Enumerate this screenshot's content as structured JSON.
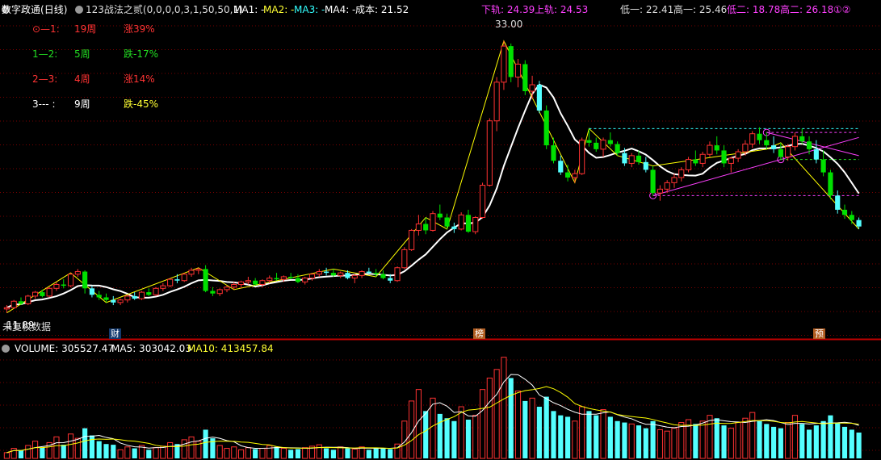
{
  "header": {
    "title": "数字政通",
    "period": "(日线)",
    "indicator": "123战法之贰(0,0,0,0,3,1,50,50,1)",
    "ma1": "MA1: -",
    "ma2": "MA2: -",
    "ma3": "MA3: -",
    "ma4": "MA4: -",
    "cost": "成本: 21.52",
    "lower_track": "下轨: 24.39",
    "upper_track": "上轨: 24.53",
    "low1": "低一: 22.41",
    "high1": "高一: 25.46",
    "low2": "低二: 18.78",
    "high2": "高二: 26.18",
    "circled": "①②"
  },
  "legend_rows": [
    {
      "label": "⊙—1:",
      "weeks": "19周",
      "change": "涨39%",
      "color": "#ff3333",
      "change_color": "#ff3333"
    },
    {
      "label": "1—2:",
      "weeks": "5周",
      "change": "跌-17%",
      "color": "#22dd22",
      "change_color": "#22dd22"
    },
    {
      "label": "2—3:",
      "weeks": "4周",
      "change": "涨14%",
      "color": "#ff3333",
      "change_color": "#ff3333"
    },
    {
      "label": "3--- :",
      "weeks": "9周",
      "change": "跌-45%",
      "color": "#ffffff",
      "change_color": "#ffff33"
    }
  ],
  "annotations": {
    "peak_label": "33.00",
    "low_label": "11.89",
    "no_data": "未复权数据",
    "tag_cai": "财",
    "tag_bang": "榜",
    "tag_yu": "预"
  },
  "volume_header": {
    "volume": "VOLUME: 305527.47",
    "ma5": "MA5: 303042.03",
    "ma10": "MA10: 413457.84"
  },
  "colors": {
    "up": "#ff3232",
    "down": "#54ffff",
    "down_candle": "#00e000",
    "ma": "#ffffff",
    "zigzag": "#ffff00",
    "channel": "#ff40ff",
    "ma5_vol": "#ffffff",
    "ma10_vol": "#ffff00",
    "grid": "#7a0000"
  },
  "chart_data": {
    "type": "candlestick",
    "price_range": [
      10.5,
      34.8
    ],
    "volume_range": [
      0,
      720000
    ],
    "peak": 33.0,
    "trough": 11.89,
    "ohlc": [
      [
        12.2,
        12.5,
        11.9,
        12.3
      ],
      [
        12.3,
        12.9,
        12.2,
        12.8
      ],
      [
        12.8,
        13.1,
        12.5,
        12.6
      ],
      [
        12.6,
        13.3,
        12.5,
        13.2
      ],
      [
        13.2,
        13.6,
        13.0,
        13.5
      ],
      [
        13.5,
        13.7,
        13.1,
        13.2
      ],
      [
        13.2,
        13.9,
        13.1,
        13.8
      ],
      [
        13.8,
        14.3,
        13.6,
        14.1
      ],
      [
        14.1,
        14.5,
        13.8,
        14.0
      ],
      [
        14.0,
        15.0,
        13.9,
        14.9
      ],
      [
        14.9,
        15.3,
        14.7,
        15.1
      ],
      [
        15.1,
        15.2,
        13.4,
        13.8
      ],
      [
        13.8,
        14.0,
        13.1,
        13.3
      ],
      [
        13.3,
        13.6,
        12.9,
        13.1
      ],
      [
        13.1,
        13.4,
        12.7,
        12.9
      ],
      [
        12.9,
        13.2,
        12.5,
        12.7
      ],
      [
        12.7,
        13.0,
        12.5,
        12.9
      ],
      [
        12.9,
        13.3,
        12.7,
        13.2
      ],
      [
        13.2,
        13.5,
        12.9,
        13.0
      ],
      [
        13.0,
        13.6,
        12.9,
        13.5
      ],
      [
        13.5,
        13.8,
        13.2,
        13.3
      ],
      [
        13.3,
        13.9,
        13.2,
        13.8
      ],
      [
        13.8,
        14.2,
        13.6,
        14.0
      ],
      [
        14.0,
        14.6,
        13.9,
        14.5
      ],
      [
        14.5,
        14.9,
        14.2,
        14.4
      ],
      [
        14.4,
        15.0,
        14.3,
        14.9
      ],
      [
        14.9,
        15.4,
        14.7,
        15.2
      ],
      [
        15.2,
        15.4,
        14.9,
        15.3
      ],
      [
        15.3,
        15.6,
        13.5,
        13.6
      ],
      [
        13.6,
        13.9,
        13.2,
        13.4
      ],
      [
        13.4,
        13.8,
        13.2,
        13.7
      ],
      [
        13.7,
        14.0,
        13.5,
        13.9
      ],
      [
        13.9,
        14.3,
        13.7,
        14.1
      ],
      [
        14.1,
        14.4,
        13.8,
        14.3
      ],
      [
        14.3,
        14.7,
        14.1,
        14.4
      ],
      [
        14.4,
        14.6,
        14.0,
        14.1
      ],
      [
        14.1,
        14.5,
        13.9,
        14.4
      ],
      [
        14.4,
        14.8,
        14.2,
        14.6
      ],
      [
        14.6,
        15.0,
        14.4,
        14.5
      ],
      [
        14.5,
        14.8,
        14.3,
        14.7
      ],
      [
        14.7,
        15.0,
        14.5,
        14.6
      ],
      [
        14.6,
        14.9,
        14.2,
        14.3
      ],
      [
        14.3,
        14.7,
        14.1,
        14.6
      ],
      [
        14.6,
        15.0,
        14.4,
        14.9
      ],
      [
        14.9,
        15.3,
        14.7,
        15.1
      ],
      [
        15.1,
        15.4,
        14.8,
        15.0
      ],
      [
        15.0,
        15.3,
        14.7,
        14.8
      ],
      [
        14.8,
        15.1,
        14.6,
        15.0
      ],
      [
        15.0,
        15.2,
        14.5,
        14.6
      ],
      [
        14.6,
        14.9,
        14.2,
        14.8
      ],
      [
        14.8,
        15.2,
        14.6,
        15.1
      ],
      [
        15.1,
        15.4,
        14.9,
        15.0
      ],
      [
        15.0,
        15.3,
        14.7,
        14.9
      ],
      [
        14.9,
        15.2,
        14.5,
        14.6
      ],
      [
        14.6,
        14.9,
        14.2,
        14.4
      ],
      [
        14.4,
        15.5,
        14.3,
        15.4
      ],
      [
        15.4,
        17.0,
        15.3,
        16.8
      ],
      [
        16.8,
        18.4,
        16.7,
        18.3
      ],
      [
        18.3,
        19.5,
        17.9,
        18.8
      ],
      [
        18.8,
        19.3,
        18.0,
        18.3
      ],
      [
        18.3,
        19.8,
        18.2,
        19.6
      ],
      [
        19.6,
        20.3,
        19.1,
        19.3
      ],
      [
        19.3,
        19.6,
        18.4,
        18.6
      ],
      [
        18.6,
        18.9,
        18.1,
        18.4
      ],
      [
        18.4,
        19.7,
        18.3,
        19.5
      ],
      [
        19.5,
        19.9,
        18.1,
        18.2
      ],
      [
        18.2,
        19.4,
        18.0,
        19.3
      ],
      [
        19.3,
        22.0,
        19.2,
        21.8
      ],
      [
        21.8,
        27.0,
        21.7,
        26.8
      ],
      [
        26.8,
        30.2,
        26.0,
        29.8
      ],
      [
        29.8,
        33.0,
        29.2,
        32.6
      ],
      [
        32.6,
        32.8,
        29.8,
        30.2
      ],
      [
        30.2,
        31.6,
        29.4,
        31.2
      ],
      [
        31.2,
        31.5,
        28.8,
        29.1
      ],
      [
        29.1,
        30.3,
        28.5,
        29.6
      ],
      [
        29.6,
        29.9,
        27.4,
        27.6
      ],
      [
        27.6,
        28.0,
        24.6,
        24.9
      ],
      [
        24.9,
        25.5,
        23.5,
        23.7
      ],
      [
        23.7,
        24.1,
        22.6,
        22.8
      ],
      [
        22.8,
        23.4,
        22.1,
        22.4
      ],
      [
        22.4,
        23.0,
        22.0,
        22.7
      ],
      [
        22.7,
        25.5,
        22.6,
        25.3
      ],
      [
        25.3,
        26.2,
        24.8,
        25.1
      ],
      [
        25.1,
        25.5,
        24.4,
        24.6
      ],
      [
        24.6,
        25.5,
        24.0,
        25.3
      ],
      [
        25.3,
        25.9,
        24.8,
        25.0
      ],
      [
        25.0,
        25.2,
        24.1,
        24.3
      ],
      [
        24.3,
        24.7,
        23.3,
        23.5
      ],
      [
        23.5,
        24.3,
        23.2,
        24.1
      ],
      [
        24.1,
        24.5,
        23.4,
        23.6
      ],
      [
        23.6,
        24.0,
        22.8,
        23.0
      ],
      [
        23.0,
        23.3,
        21.0,
        21.2
      ],
      [
        21.2,
        21.8,
        20.6,
        21.5
      ],
      [
        21.5,
        22.2,
        21.2,
        22.0
      ],
      [
        22.0,
        22.7,
        21.6,
        22.4
      ],
      [
        22.4,
        23.2,
        22.1,
        23.0
      ],
      [
        23.0,
        24.0,
        22.8,
        23.8
      ],
      [
        23.8,
        24.5,
        23.3,
        23.5
      ],
      [
        23.5,
        24.4,
        23.2,
        24.2
      ],
      [
        24.2,
        25.2,
        24.0,
        24.9
      ],
      [
        24.9,
        25.6,
        24.2,
        24.5
      ],
      [
        24.5,
        24.9,
        23.2,
        23.5
      ],
      [
        23.5,
        24.0,
        22.8,
        23.9
      ],
      [
        23.9,
        24.6,
        23.6,
        24.4
      ],
      [
        24.4,
        25.3,
        24.1,
        25.0
      ],
      [
        25.0,
        26.0,
        24.7,
        25.8
      ],
      [
        25.8,
        26.3,
        25.0,
        25.3
      ],
      [
        25.3,
        25.9,
        24.6,
        24.9
      ],
      [
        24.9,
        25.6,
        24.3,
        24.6
      ],
      [
        24.6,
        25.1,
        23.8,
        24.0
      ],
      [
        24.0,
        25.0,
        23.7,
        24.8
      ],
      [
        24.8,
        25.9,
        24.5,
        25.6
      ],
      [
        25.6,
        26.2,
        25.0,
        25.2
      ],
      [
        25.2,
        25.6,
        24.2,
        24.6
      ],
      [
        24.6,
        25.3,
        23.5,
        23.8
      ],
      [
        23.8,
        24.5,
        22.5,
        22.8
      ],
      [
        22.8,
        23.0,
        20.7,
        21.0
      ],
      [
        21.0,
        21.4,
        19.6,
        19.9
      ],
      [
        19.9,
        20.3,
        19.2,
        19.5
      ],
      [
        19.5,
        19.8,
        18.8,
        19.1
      ],
      [
        19.1,
        19.3,
        18.4,
        18.6
      ]
    ],
    "volume": [
      40000,
      70000,
      55000,
      90000,
      120000,
      75000,
      110000,
      150000,
      95000,
      170000,
      140000,
      210000,
      160000,
      120000,
      100000,
      95000,
      60000,
      80000,
      70000,
      90000,
      60000,
      75000,
      85000,
      110000,
      100000,
      130000,
      150000,
      120000,
      200000,
      140000,
      90000,
      70000,
      80000,
      60000,
      75000,
      65000,
      70000,
      90000,
      80000,
      70000,
      60000,
      65000,
      75000,
      85000,
      95000,
      70000,
      60000,
      80000,
      70000,
      65000,
      80000,
      60000,
      75000,
      70000,
      65000,
      100000,
      260000,
      400000,
      480000,
      330000,
      420000,
      310000,
      280000,
      260000,
      360000,
      270000,
      300000,
      480000,
      560000,
      620000,
      705000,
      560000,
      470000,
      400000,
      420000,
      360000,
      430000,
      330000,
      300000,
      290000,
      260000,
      360000,
      330000,
      300000,
      340000,
      290000,
      260000,
      250000,
      240000,
      230000,
      210000,
      260000,
      200000,
      190000,
      210000,
      250000,
      270000,
      240000,
      260000,
      300000,
      280000,
      230000,
      210000,
      250000,
      280000,
      320000,
      260000,
      240000,
      220000,
      210000,
      250000,
      300000,
      240000,
      200000,
      230000,
      260000,
      300000,
      250000,
      220000,
      200000,
      180000
    ]
  }
}
